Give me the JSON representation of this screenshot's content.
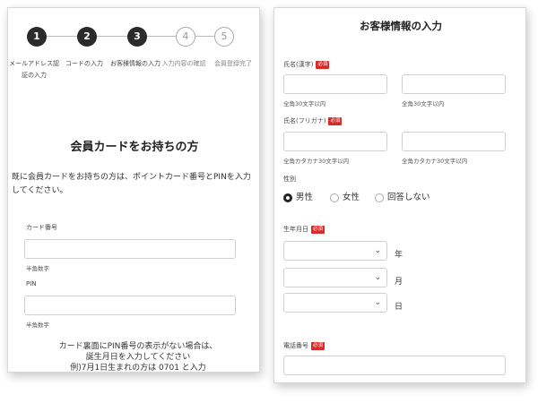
{
  "stepper": {
    "steps": [
      {
        "number": "1",
        "label": "メールアドレス認証の入力",
        "state": "done"
      },
      {
        "number": "2",
        "label": "コードの入力",
        "state": "done"
      },
      {
        "number": "3",
        "label": "お客様情報の入力",
        "state": "done"
      },
      {
        "number": "4",
        "label": "入力内容の確認",
        "state": "todo"
      },
      {
        "number": "5",
        "label": "会員登録完了",
        "state": "todo"
      }
    ]
  },
  "member_card": {
    "title": "会員カードをお持ちの方",
    "description": "既に会員カードをお持ちの方は、ポイントカード番号とPINを入力してください。",
    "card_number_label": "カード番号",
    "card_number_value": "",
    "card_number_hint": "半角数字",
    "pin_label": "PIN",
    "pin_value": "",
    "pin_hint": "半角数字",
    "notice_line1": "カード裏面にPIN番号の表示がない場合は、",
    "notice_line2": "誕生月日を入力してください",
    "notice_line3": "例)7月1日生まれの方は 0701 と入力"
  },
  "customer_info": {
    "title": "お客様情報の入力",
    "required_badge": "必須",
    "name_kanji_label": "氏名(漢字)",
    "name_kanji_last": "",
    "name_kanji_first": "",
    "name_kanji_hint_last": "全角30文字以内",
    "name_kanji_hint_first": "全角30文字以内",
    "name_kana_label": "氏名(フリガナ)",
    "name_kana_last": "",
    "name_kana_first": "",
    "name_kana_hint_last": "全角カタカナ30文字以内",
    "name_kana_hint_first": "全角カタカナ30文字以内",
    "gender_label": "性別",
    "gender_options": [
      "男性",
      "女性",
      "回答しない"
    ],
    "gender_selected": "男性",
    "birthdate_label": "生年月日",
    "birth_year_value": "",
    "birth_month_value": "",
    "birth_day_value": "",
    "year_unit": "年",
    "month_unit": "月",
    "day_unit": "日",
    "phone_label": "電話番号",
    "phone_value": ""
  }
}
